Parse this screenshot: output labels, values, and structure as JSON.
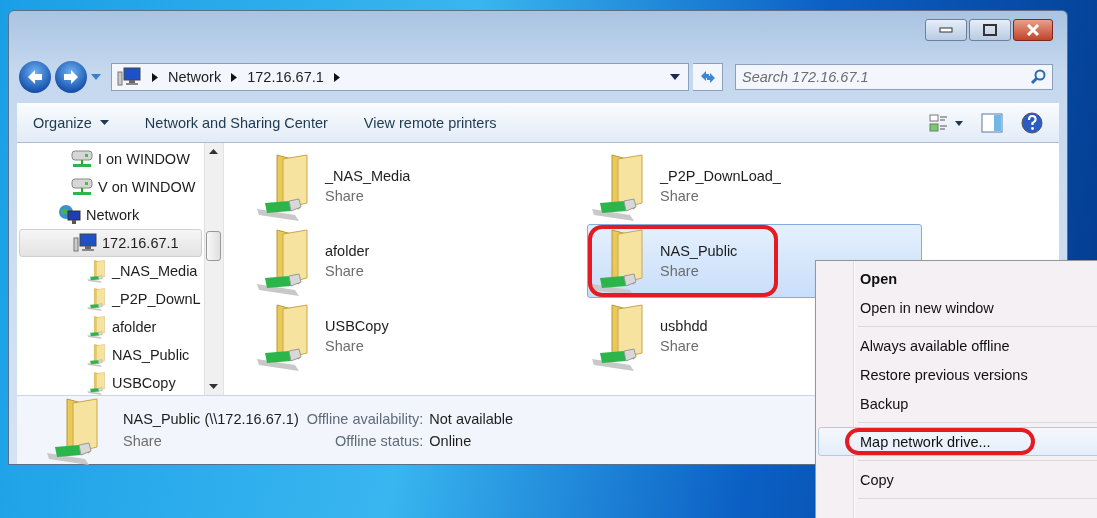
{
  "address_bar": {
    "breadcrumbs": [
      "Network",
      "172.16.67.1"
    ]
  },
  "search": {
    "placeholder": "Search 172.16.67.1"
  },
  "toolbar": {
    "items": [
      {
        "label": "Organize",
        "dropdown": true
      },
      {
        "label": "Network and Sharing Center",
        "dropdown": false
      },
      {
        "label": "View remote printers",
        "dropdown": false
      }
    ]
  },
  "nav_tree": {
    "items": [
      {
        "label": "I on WINDOW",
        "kind": "drive",
        "selected": false
      },
      {
        "label": "V on WINDOW",
        "kind": "drive",
        "selected": false
      },
      {
        "label": "Network",
        "kind": "network",
        "selected": false,
        "children": [
          {
            "label": "172.16.67.1",
            "kind": "computer",
            "selected": true,
            "children": [
              {
                "label": "_NAS_Media",
                "kind": "share",
                "selected": false
              },
              {
                "label": "_P2P_DownL",
                "kind": "share",
                "selected": false
              },
              {
                "label": "afolder",
                "kind": "share",
                "selected": false
              },
              {
                "label": "NAS_Public",
                "kind": "share",
                "selected": false
              },
              {
                "label": "USBCopy",
                "kind": "share",
                "selected": false
              }
            ]
          }
        ]
      }
    ]
  },
  "shares": [
    {
      "name": "_NAS_Media",
      "type": "Share",
      "selected": false,
      "highlighted": false
    },
    {
      "name": "_P2P_DownLoad_",
      "type": "Share",
      "selected": false,
      "highlighted": false
    },
    {
      "name": "afolder",
      "type": "Share",
      "selected": false,
      "highlighted": false
    },
    {
      "name": "NAS_Public",
      "type": "Share",
      "selected": true,
      "highlighted": true
    },
    {
      "name": "USBCopy",
      "type": "Share",
      "selected": false,
      "highlighted": false
    },
    {
      "name": "usbhdd",
      "type": "Share",
      "selected": false,
      "highlighted": false
    }
  ],
  "details": {
    "name": "NAS_Public (\\\\172.16.67.1)",
    "type": "Share",
    "fields": [
      {
        "label": "Offline availability:",
        "value": "Not available"
      },
      {
        "label": "Offline status:",
        "value": "Online"
      }
    ]
  },
  "context_menu": {
    "groups": [
      {
        "items": [
          {
            "label": "Open",
            "default": true,
            "selected": false,
            "highlighted": false
          },
          {
            "label": "Open in new window",
            "default": false,
            "selected": false,
            "highlighted": false
          }
        ]
      },
      {
        "items": [
          {
            "label": "Always available offline",
            "default": false,
            "selected": false,
            "highlighted": false
          },
          {
            "label": "Restore previous versions",
            "default": false,
            "selected": false,
            "highlighted": false
          },
          {
            "label": "Backup",
            "default": false,
            "selected": false,
            "highlighted": false
          }
        ]
      },
      {
        "items": [
          {
            "label": "Map network drive...",
            "default": false,
            "selected": true,
            "highlighted": true
          }
        ]
      },
      {
        "items": [
          {
            "label": "Copy",
            "default": false,
            "selected": false,
            "highlighted": false
          }
        ]
      }
    ]
  }
}
